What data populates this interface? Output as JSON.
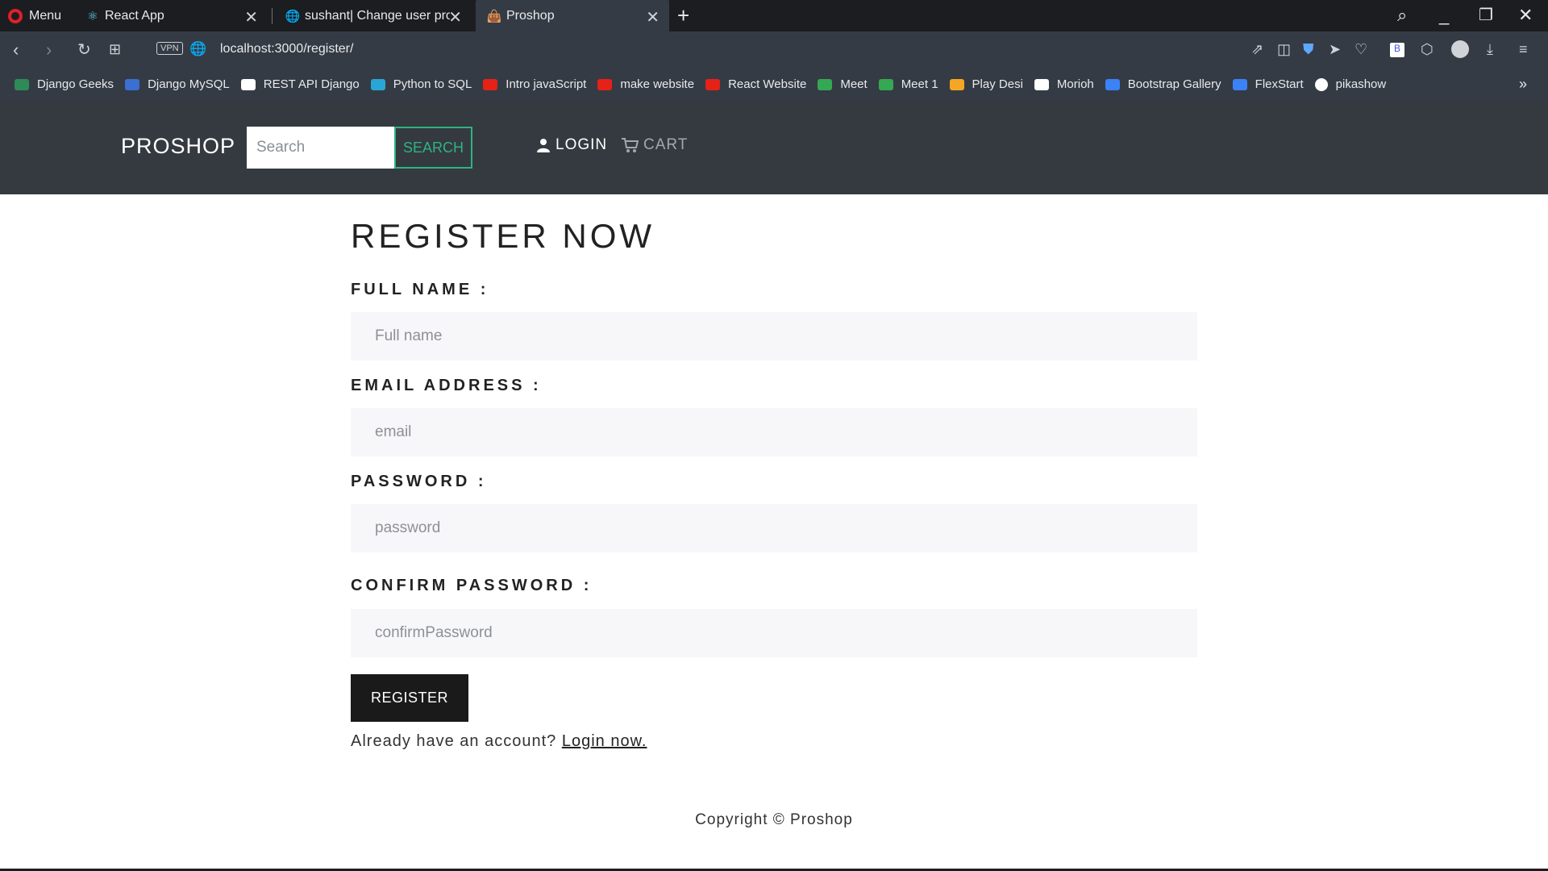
{
  "browser": {
    "menu_label": "Menu",
    "tabs": [
      {
        "title": "React App"
      },
      {
        "title": "sushant| Change user prof"
      },
      {
        "title": "Proshop"
      }
    ],
    "url": "localhost:3000/register/",
    "vpn_label": "VPN",
    "bookmarks": [
      {
        "label": "Django Geeks",
        "color": "#2e8b57"
      },
      {
        "label": "Django MySQL",
        "color": "#3b6fd1"
      },
      {
        "label": "REST API Django",
        "color": "#ffffff"
      },
      {
        "label": "Python to SQL",
        "color": "#2aa6d6"
      },
      {
        "label": "Intro javaScript",
        "color": "#e62117"
      },
      {
        "label": "make website",
        "color": "#e62117"
      },
      {
        "label": "React Website",
        "color": "#e62117"
      },
      {
        "label": "Meet",
        "color": "#34a853"
      },
      {
        "label": "Meet 1",
        "color": "#34a853"
      },
      {
        "label": "Play Desi",
        "color": "#f5a623"
      },
      {
        "label": "Morioh",
        "color": "#ffffff"
      },
      {
        "label": "Bootstrap Gallery",
        "color": "#3b82f6"
      },
      {
        "label": "FlexStart",
        "color": "#3b82f6"
      },
      {
        "label": "pikashow",
        "color": "#ffffff"
      }
    ]
  },
  "navbar": {
    "brand": "PROSHOP",
    "search_placeholder": "Search",
    "search_button": "SEARCH",
    "login": "LOGIN",
    "cart": "CART"
  },
  "form": {
    "title": "REGISTER NOW",
    "full_name_label": "FULL NAME :",
    "full_name_placeholder": "Full name",
    "email_label": "EMAIL ADDRESS :",
    "email_placeholder": "email",
    "password_label": "PASSWORD :",
    "password_placeholder": "password",
    "confirm_label": "CONFIRM PASSWORD :",
    "confirm_placeholder": "confirmPassword",
    "register_button": "REGISTER",
    "login_prompt": "Already have an account?",
    "login_link": "Login now."
  },
  "footer": {
    "copyright": "Copyright © Proshop"
  },
  "colors": {
    "navbar_bg": "#343a40",
    "accent_green": "#2fb380",
    "button_dark": "#1a1a1a"
  }
}
